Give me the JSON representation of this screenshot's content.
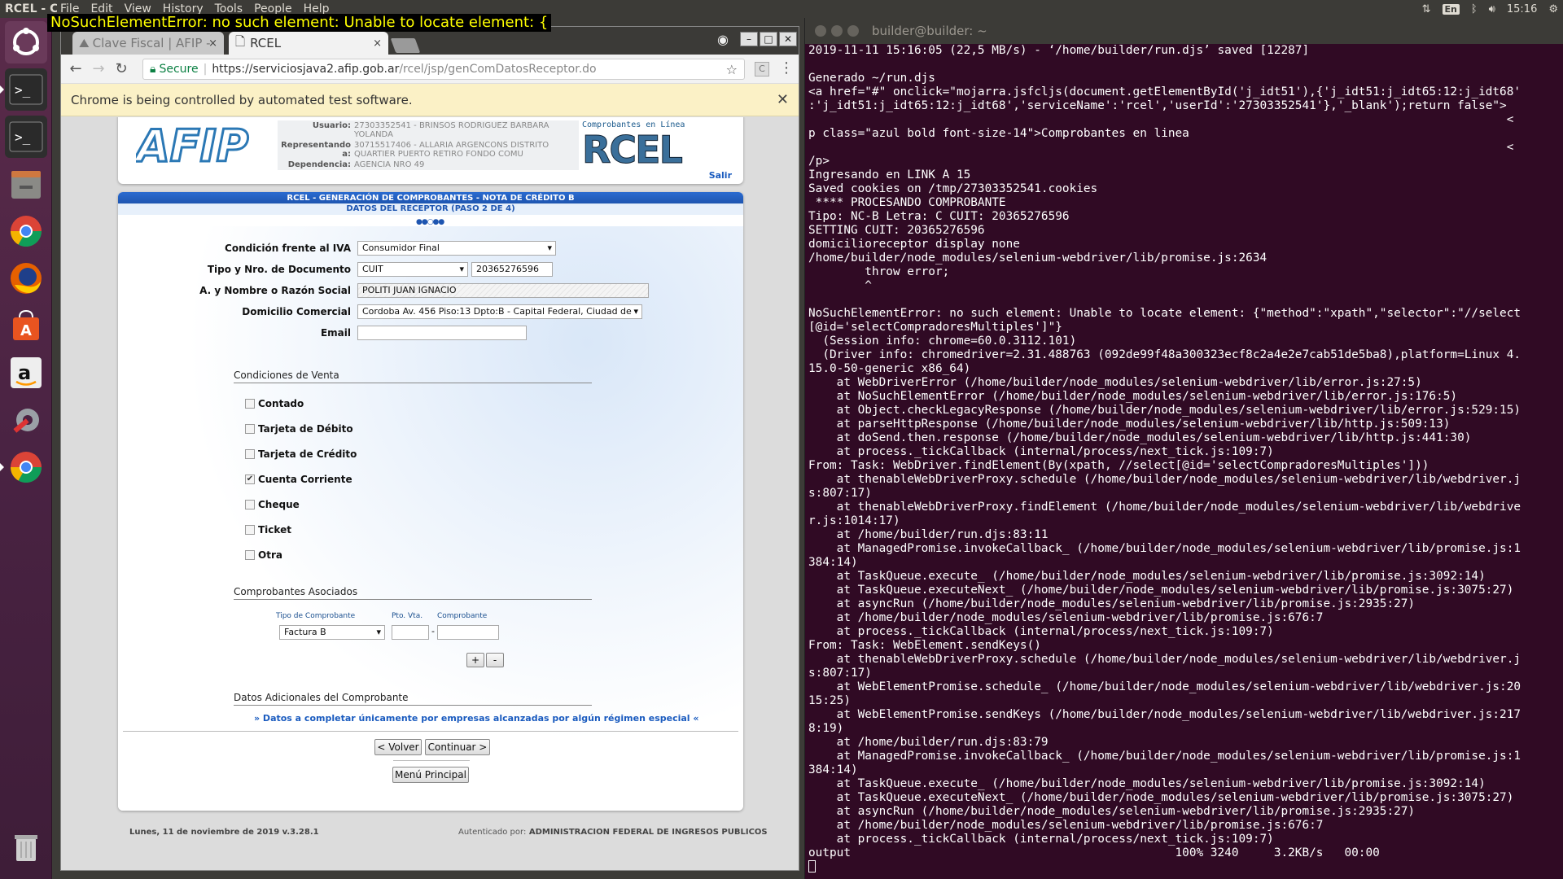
{
  "top_panel": {
    "app_title": "RCEL - C",
    "menu": [
      "File",
      "Edit",
      "View",
      "History",
      "Tools",
      "People",
      "Help"
    ],
    "error_overlay": "NoSuchElementError: no such element: Unable to locate element: {",
    "keyboard": "En",
    "time": "15:16"
  },
  "browser": {
    "tabs": [
      {
        "label": "Clave Fiscal | AFIP -",
        "close": "×"
      },
      {
        "label": "RCEL",
        "close": "×"
      }
    ],
    "secure_label": "Secure",
    "url_host": "https://serviciosjava2.afip.gob.ar",
    "url_path": "/rcel/jsp/genComDatosReceptor.do",
    "infobar": "Chrome is being controlled by automated test software."
  },
  "header": {
    "logo_text": "AFIP",
    "usuario_label": "Usuario:",
    "usuario_value": "27303352541 - BRINSOS RODRIGUEZ BARBARA YOLANDA",
    "representando_label": "Representando a:",
    "representando_value": "30715517406 - ALLARIA ARGENCONS DISTRITO QUARTIER PUERTO RETIRO FONDO COMU",
    "dependencia_label": "Dependencia:",
    "dependencia_value": "AGENCIA NRO 49",
    "rcel_small": "Comprobantes en Línea",
    "rcel_big": "RCEL",
    "salir": "Salir"
  },
  "form": {
    "band_title": "RCEL - GENERACIÓN DE COMPROBANTES - NOTA DE CRÉDITO B",
    "band_subtitle": "DATOS DEL RECEPTOR (PASO 2 DE 4)",
    "steps": "●●○●●",
    "condicion_iva_label": "Condición frente al IVA",
    "condicion_iva_value": "Consumidor Final",
    "tipo_doc_label": "Tipo y Nro. de Documento",
    "tipo_doc_value": "CUIT",
    "nro_doc_value": "20365276596",
    "nombre_label": "A. y Nombre o Razón Social",
    "nombre_value": "POLITI JUAN IGNACIO",
    "domicilio_label": "Domicilio Comercial",
    "domicilio_value": "Cordoba Av. 456 Piso:13 Dpto:B - Capital Federal, Ciudad de",
    "email_label": "Email",
    "email_value": "",
    "condiciones_title": "Condiciones de Venta",
    "condiciones": [
      {
        "label": "Contado",
        "checked": false
      },
      {
        "label": "Tarjeta de Débito",
        "checked": false
      },
      {
        "label": "Tarjeta de Crédito",
        "checked": false
      },
      {
        "label": "Cuenta Corriente",
        "checked": true
      },
      {
        "label": "Cheque",
        "checked": false
      },
      {
        "label": "Ticket",
        "checked": false
      },
      {
        "label": "Otra",
        "checked": false
      }
    ],
    "asociados_title": "Comprobantes Asociados",
    "tipo_comprobante_label": "Tipo de Comprobante",
    "pto_vta_label": "Pto. Vta.",
    "comprobante_label": "Comprobante",
    "tipo_comprobante_value": "Factura B",
    "dash": "-",
    "add_label": "+",
    "remove_label": "-",
    "adicionales_title": "Datos Adicionales del Comprobante",
    "adicionales_link": "» Datos a completar únicamente por empresas alcanzadas por algún régimen especial «",
    "volver_label": "< Volver",
    "continuar_label": "Continuar >",
    "menu_principal_label": "Menú Principal",
    "footer_left": "Lunes, 11 de noviembre de 2019 v.3.28.1",
    "footer_auth_label": "Autenticado por:",
    "footer_auth_value": "ADMINISTRACION FEDERAL DE INGRESOS PUBLICOS"
  },
  "terminal": {
    "title": "builder@builder: ~",
    "lines": [
      "2019-11-11 15:16:05 (22,5 MB/s) - ‘/home/builder/run.djs’ saved [12287]",
      "",
      "Generado ~/run.djs",
      "<a href=\"#\" onclick=\"mojarra.jsfcljs(document.getElementById('j_idt51'),{'j_idt51:j_idt65:12:j_idt68'",
      ":'j_idt51:j_idt65:12:j_idt68','serviceName':'rcel','userId':'27303352541'},'_blank');return false\">",
      "                                                                                                   <",
      "p class=\"azul bold font-size-14\">Comprobantes en linea",
      "                                                                                                   <",
      "/p>",
      "Ingresando en LINK A 15",
      "Saved cookies on /tmp/27303352541.cookies",
      " **** PROCESANDO COMPROBANTE",
      "Tipo: NC-B Letra: C CUIT: 20365276596",
      "SETTING CUIT: 20365276596",
      "domicilioreceptor display none",
      "/home/builder/node_modules/selenium-webdriver/lib/promise.js:2634",
      "        throw error;",
      "        ^",
      "",
      "NoSuchElementError: no such element: Unable to locate element: {\"method\":\"xpath\",\"selector\":\"//select",
      "[@id='selectCompradoresMultiples']\"}",
      "  (Session info: chrome=60.0.3112.101)",
      "  (Driver info: chromedriver=2.31.488763 (092de99f48a300323ecf8c2a4e2e7cab51de5ba8),platform=Linux 4.",
      "15.0-50-generic x86_64)",
      "    at WebDriverError (/home/builder/node_modules/selenium-webdriver/lib/error.js:27:5)",
      "    at NoSuchElementError (/home/builder/node_modules/selenium-webdriver/lib/error.js:176:5)",
      "    at Object.checkLegacyResponse (/home/builder/node_modules/selenium-webdriver/lib/error.js:529:15)",
      "    at parseHttpResponse (/home/builder/node_modules/selenium-webdriver/lib/http.js:509:13)",
      "    at doSend.then.response (/home/builder/node_modules/selenium-webdriver/lib/http.js:441:30)",
      "    at process._tickCallback (internal/process/next_tick.js:109:7)",
      "From: Task: WebDriver.findElement(By(xpath, //select[@id='selectCompradoresMultiples']))",
      "    at thenableWebDriverProxy.schedule (/home/builder/node_modules/selenium-webdriver/lib/webdriver.j",
      "s:807:17)",
      "    at thenableWebDriverProxy.findElement (/home/builder/node_modules/selenium-webdriver/lib/webdrive",
      "r.js:1014:17)",
      "    at /home/builder/run.djs:83:11",
      "    at ManagedPromise.invokeCallback_ (/home/builder/node_modules/selenium-webdriver/lib/promise.js:1",
      "384:14)",
      "    at TaskQueue.execute_ (/home/builder/node_modules/selenium-webdriver/lib/promise.js:3092:14)",
      "    at TaskQueue.executeNext_ (/home/builder/node_modules/selenium-webdriver/lib/promise.js:3075:27)",
      "    at asyncRun (/home/builder/node_modules/selenium-webdriver/lib/promise.js:2935:27)",
      "    at /home/builder/node_modules/selenium-webdriver/lib/promise.js:676:7",
      "    at process._tickCallback (internal/process/next_tick.js:109:7)",
      "From: Task: WebElement.sendKeys()",
      "    at thenableWebDriverProxy.schedule (/home/builder/node_modules/selenium-webdriver/lib/webdriver.j",
      "s:807:17)",
      "    at WebElementPromise.schedule_ (/home/builder/node_modules/selenium-webdriver/lib/webdriver.js:20",
      "15:25)",
      "    at WebElementPromise.sendKeys (/home/builder/node_modules/selenium-webdriver/lib/webdriver.js:217",
      "8:19)",
      "    at /home/builder/run.djs:83:79",
      "    at ManagedPromise.invokeCallback_ (/home/builder/node_modules/selenium-webdriver/lib/promise.js:1",
      "384:14)",
      "    at TaskQueue.execute_ (/home/builder/node_modules/selenium-webdriver/lib/promise.js:3092:14)",
      "    at TaskQueue.executeNext_ (/home/builder/node_modules/selenium-webdriver/lib/promise.js:3075:27)",
      "    at asyncRun (/home/builder/node_modules/selenium-webdriver/lib/promise.js:2935:27)",
      "    at /home/builder/node_modules/selenium-webdriver/lib/promise.js:676:7",
      "    at process._tickCallback (internal/process/next_tick.js:109:7)",
      "output                                              100% 3240     3.2KB/s   00:00"
    ]
  },
  "launcher": [
    "ubuntu-logo-icon",
    "terminal-icon",
    "terminal-icon",
    "file-manager-icon",
    "chrome-icon",
    "firefox-icon",
    "software-center-icon",
    "amazon-icon",
    "settings-icon",
    "chrome-icon",
    "trash-icon"
  ]
}
